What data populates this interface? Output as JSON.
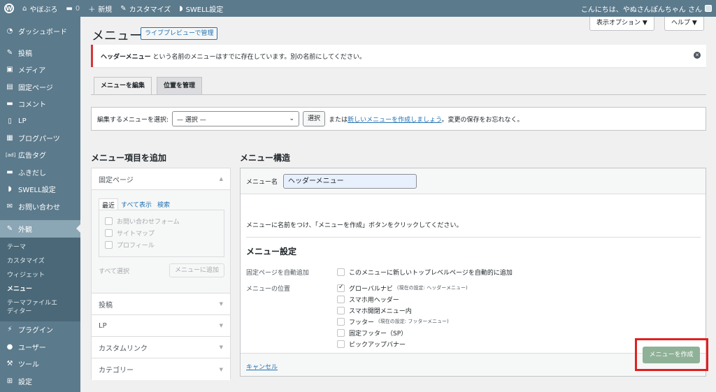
{
  "adminbar": {
    "site_name": "やぼぶろ",
    "comments_count": "0",
    "new_label": "新規",
    "customize_label": "カスタマイズ",
    "swell_label": "SWELL設定",
    "greeting": "こんにちは、やぬさんぽんちゃん さん"
  },
  "sidebar": {
    "items": [
      {
        "label": "ダッシュボード",
        "icon": "dashboard-icon",
        "glyph": "◔"
      },
      {
        "label": "投稿",
        "icon": "pin-icon",
        "glyph": "✎"
      },
      {
        "label": "メディア",
        "icon": "media-icon",
        "glyph": "▣"
      },
      {
        "label": "固定ページ",
        "icon": "page-icon",
        "glyph": "▤"
      },
      {
        "label": "コメント",
        "icon": "comment-icon",
        "glyph": "▬"
      },
      {
        "label": "LP",
        "icon": "document-icon",
        "glyph": "▯"
      },
      {
        "label": "ブログパーツ",
        "icon": "parts-icon",
        "glyph": "▦"
      },
      {
        "label": "広告タグ",
        "icon": "ad-icon",
        "glyph": "[ad]"
      },
      {
        "label": "ふきだし",
        "icon": "balloon-icon",
        "glyph": "▬"
      },
      {
        "label": "SWELL設定",
        "icon": "swell-icon",
        "glyph": "◗"
      },
      {
        "label": "お問い合わせ",
        "icon": "mail-icon",
        "glyph": "✉"
      },
      {
        "label": "外観",
        "icon": "appearance-icon",
        "glyph": "✎"
      }
    ],
    "submenu": [
      "テーマ",
      "カスタマイズ",
      "ウィジェット",
      "メニュー",
      "テーマファイルエディター"
    ],
    "bottom_items": [
      {
        "label": "プラグイン",
        "icon": "plugin-icon",
        "glyph": "⚡"
      },
      {
        "label": "ユーザー",
        "icon": "user-icon",
        "glyph": "●"
      },
      {
        "label": "ツール",
        "icon": "wrench-icon",
        "glyph": "⚒"
      },
      {
        "label": "設定",
        "icon": "settings-icon",
        "glyph": "⊞"
      }
    ]
  },
  "header": {
    "title": "メニュー",
    "live_preview": "ライブプレビューで管理",
    "screen_options": "表示オプション ▼",
    "help": "ヘルプ ▼"
  },
  "notice": {
    "bold": "ヘッダーメニュー",
    "text": " という名前のメニューはすでに存在しています。別の名前にしてください。"
  },
  "tabs": {
    "edit": "メニューを編集",
    "locations": "位置を管理"
  },
  "select_bar": {
    "label": "編集するメニューを選択:",
    "selected": "— 選択 —",
    "button": "選択",
    "or_text": "または",
    "create_link": "新しいメニューを作成しましょう",
    "tail": "。変更の保存をお忘れなく。"
  },
  "add_items": {
    "title": "メニュー項目を追加",
    "pages_heading": "固定ページ",
    "mini_tabs": [
      "最近",
      "すべて表示",
      "検索"
    ],
    "pages": [
      "お問い合わせフォーム",
      "サイトマップ",
      "プロフィール"
    ],
    "select_all": "すべて選択",
    "add_button": "メニューに追加",
    "sections": [
      "投稿",
      "LP",
      "カスタムリンク",
      "カテゴリー"
    ]
  },
  "structure": {
    "title": "メニュー構造",
    "name_label": "メニュー名",
    "name_value": "ヘッダーメニュー",
    "hint": "メニューに名前をつけ、「メニューを作成」ボタンをクリックしてください。",
    "settings_title": "メニュー設定",
    "auto_add_label": "固定ページを自動追加",
    "auto_add_option": "このメニューに新しいトップレベルページを自動的に追加",
    "location_label": "メニューの位置",
    "locations": [
      {
        "label": "グローバルナビ",
        "note": "(現在の設定: ヘッダーメニュー)",
        "checked": true
      },
      {
        "label": "スマホ用ヘッダー",
        "note": "",
        "checked": false
      },
      {
        "label": "スマホ開閉メニュー内",
        "note": "",
        "checked": false
      },
      {
        "label": "フッター",
        "note": "(現在の設定: フッターメニュー)",
        "checked": false
      },
      {
        "label": "固定フッター（SP）",
        "note": "",
        "checked": false
      },
      {
        "label": "ピックアップバナー",
        "note": "",
        "checked": false
      }
    ],
    "cancel": "キャンセル",
    "create_button": "メニューを作成"
  }
}
